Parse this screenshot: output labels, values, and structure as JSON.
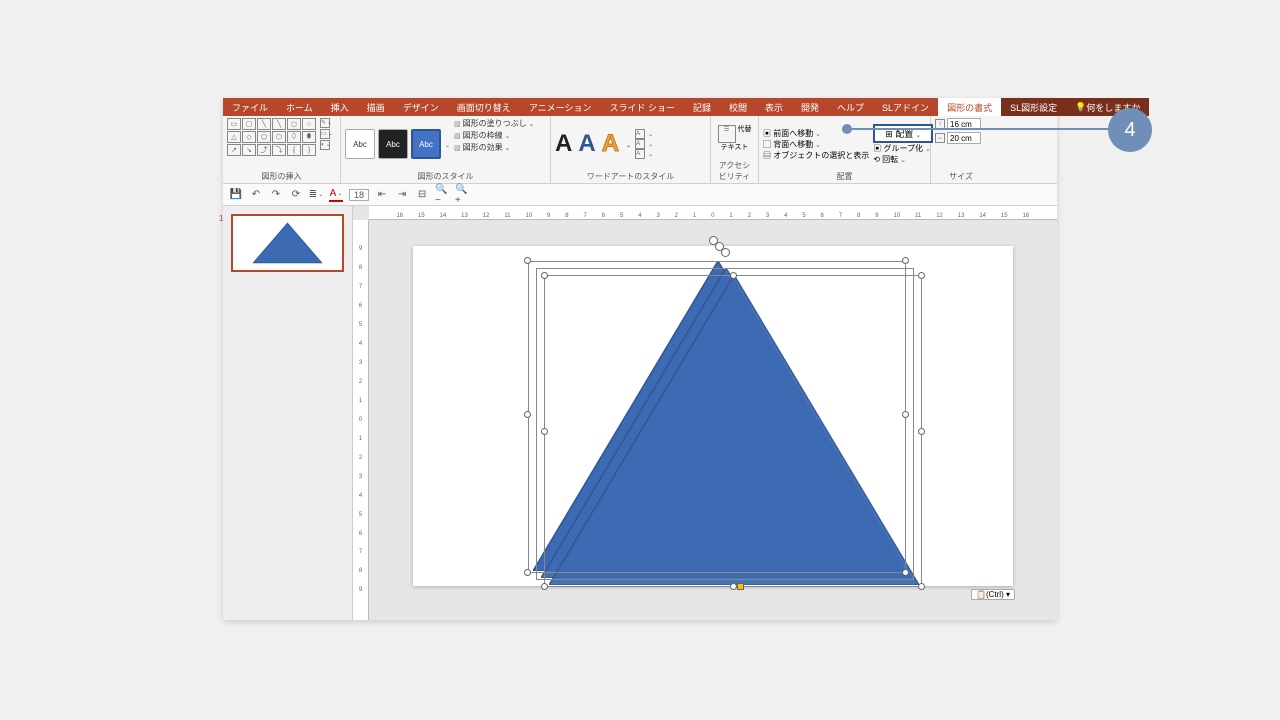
{
  "tabs": {
    "file": "ファイル",
    "home": "ホーム",
    "insert": "挿入",
    "draw": "描画",
    "design": "デザイン",
    "transitions": "画面切り替え",
    "animations": "アニメーション",
    "slideshow": "スライド ショー",
    "record": "記録",
    "review": "校閲",
    "view": "表示",
    "developer": "開発",
    "help": "ヘルプ",
    "sladdin": "SLアドイン",
    "shapeformat": "図形の書式",
    "slshape": "SL図形設定",
    "tellme": "何をしますか"
  },
  "groups": {
    "insert_shapes": "図形の挿入",
    "shape_styles": "図形のスタイル",
    "wordart_styles": "ワードアートのスタイル",
    "accessibility": "アクセシビリティ",
    "arrange": "配置",
    "size": "サイズ"
  },
  "shape_style_opts": {
    "fill": "図形の塗りつぶし",
    "outline": "図形の枠線",
    "effects": "図形の効果"
  },
  "style_abc": "Abc",
  "wordart_letter": "A",
  "accessibility_btn": "代替テキスト",
  "arrange_opts": {
    "bring_forward": "前面へ移動",
    "send_backward": "背面へ移動",
    "selection_pane": "オブジェクトの選択と表示",
    "align": "配置",
    "group": "グループ化",
    "rotate": "回転"
  },
  "size_vals": {
    "height": "16 cm",
    "width": "20 cm"
  },
  "qat": {
    "font_size": "18"
  },
  "thumb_number": "1",
  "ctrl_hint": "(Ctrl)",
  "callout_number": "4",
  "ruler_ticks": [
    "16",
    "15",
    "14",
    "13",
    "12",
    "11",
    "10",
    "9",
    "8",
    "7",
    "6",
    "5",
    "4",
    "3",
    "2",
    "1",
    "0",
    "1",
    "2",
    "3",
    "4",
    "5",
    "6",
    "7",
    "8",
    "9",
    "10",
    "11",
    "12",
    "13",
    "14",
    "15",
    "16"
  ],
  "ruler_v_ticks": [
    "9",
    "8",
    "7",
    "6",
    "5",
    "4",
    "3",
    "2",
    "1",
    "0",
    "1",
    "2",
    "3",
    "4",
    "5",
    "6",
    "7",
    "8",
    "9"
  ],
  "colors": {
    "accent": "#b7472a",
    "triangle": "#3d6bb3",
    "triangle_stroke": "#2f5597",
    "callout": "#6f8fb8"
  }
}
